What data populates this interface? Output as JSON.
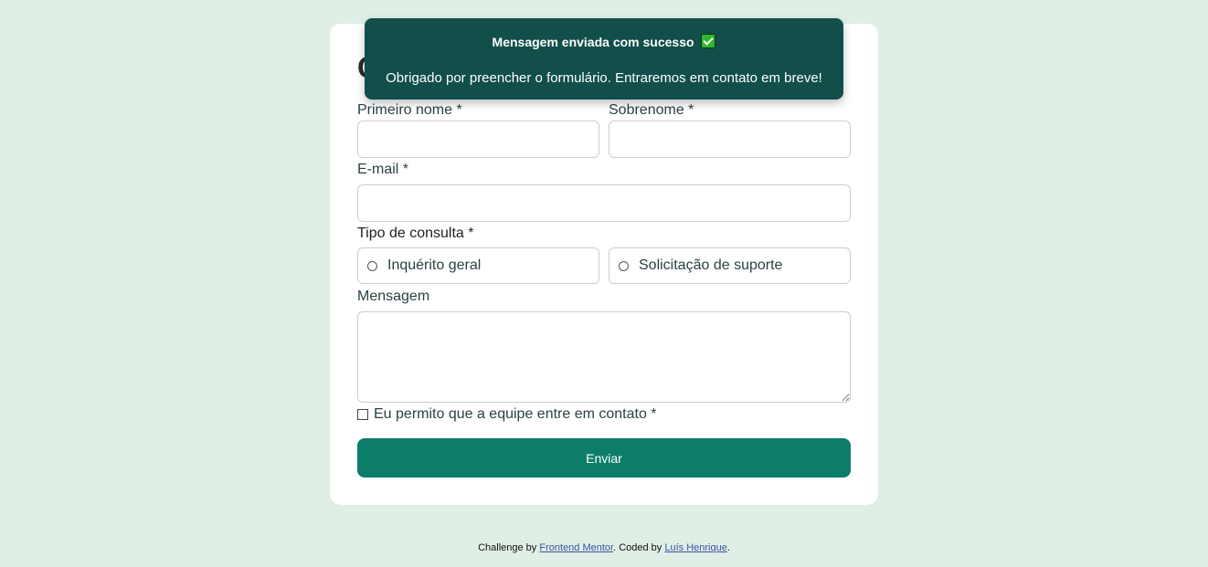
{
  "form": {
    "title": "C",
    "first_name": {
      "label": "Primeiro nome *",
      "value": ""
    },
    "last_name": {
      "label": "Sobrenome *",
      "value": ""
    },
    "email": {
      "label": "E-mail *",
      "value": ""
    },
    "query_type": {
      "legend": "Tipo de consulta *",
      "options": [
        {
          "label": "Inquérito geral",
          "selected": false
        },
        {
          "label": "Solicitação de suporte",
          "selected": false
        }
      ]
    },
    "message": {
      "label": "Mensagem",
      "value": ""
    },
    "consent": {
      "label": "Eu permito que a equipe entre em contato *",
      "checked": false
    },
    "submit_label": "Enviar"
  },
  "toast": {
    "title": "Mensagem enviada com sucesso",
    "icon": "check-icon",
    "message": "Obrigado por preencher o formulário. Entraremos em contato em breve!"
  },
  "footer": {
    "prefix": "Challenge by ",
    "link1": "Frontend Mentor",
    "middle": ". Coded by ",
    "link2": "Luís Henrique",
    "suffix": "."
  },
  "colors": {
    "background": "#dfefe6",
    "accent": "#0c7d69",
    "toast_bg": "#124e4a"
  }
}
